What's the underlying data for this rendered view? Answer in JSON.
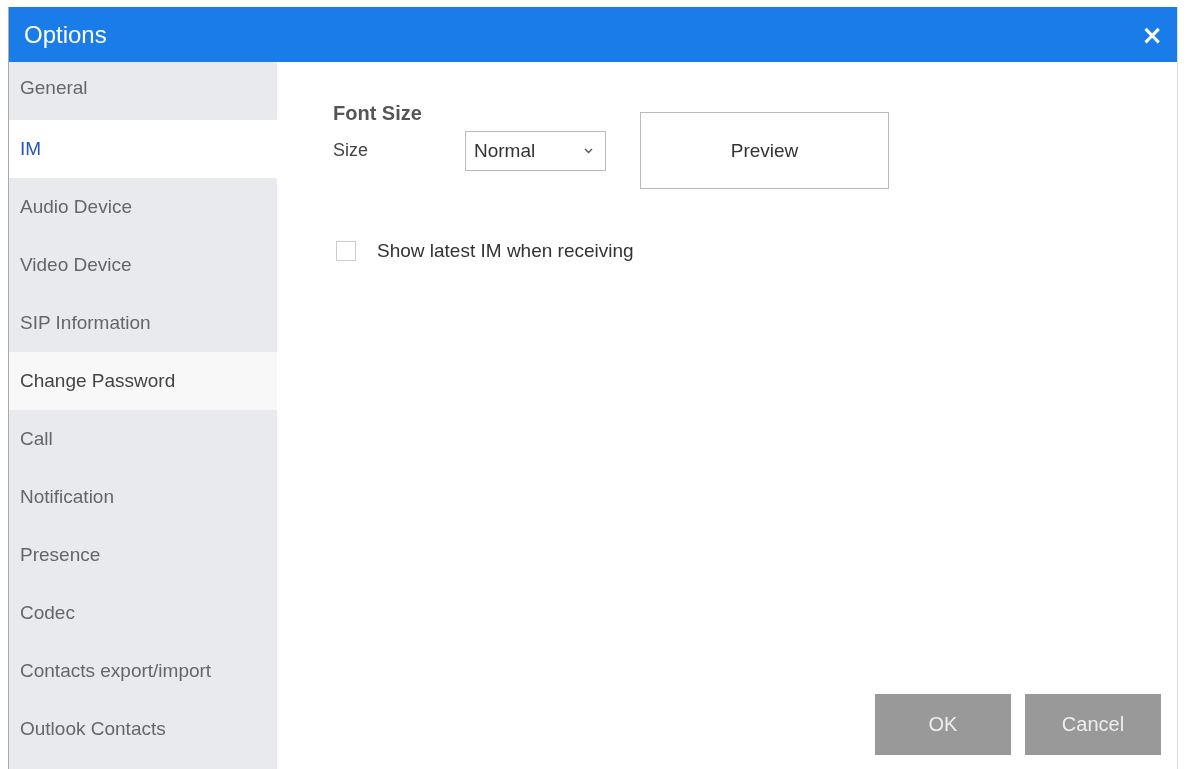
{
  "window": {
    "title": "Options",
    "close": "×"
  },
  "sidebar": {
    "items": [
      {
        "label": "General",
        "selected": false,
        "hovered": false
      },
      {
        "label": "IM",
        "selected": true,
        "hovered": false
      },
      {
        "label": "Audio Device",
        "selected": false,
        "hovered": false
      },
      {
        "label": "Video Device",
        "selected": false,
        "hovered": false
      },
      {
        "label": "SIP Information",
        "selected": false,
        "hovered": false
      },
      {
        "label": "Change Password",
        "selected": false,
        "hovered": true
      },
      {
        "label": "Call",
        "selected": false,
        "hovered": false
      },
      {
        "label": "Notification",
        "selected": false,
        "hovered": false
      },
      {
        "label": "Presence",
        "selected": false,
        "hovered": false
      },
      {
        "label": "Codec",
        "selected": false,
        "hovered": false
      },
      {
        "label": "Contacts export/import",
        "selected": false,
        "hovered": false
      },
      {
        "label": "Outlook Contacts",
        "selected": false,
        "hovered": false
      }
    ]
  },
  "content": {
    "section_title": "Font Size",
    "size_label": "Size",
    "size_value": "Normal",
    "preview_button": "Preview",
    "checkbox": {
      "label": "Show latest IM when receiving",
      "checked": false
    }
  },
  "buttons": [
    {
      "label": "OK"
    },
    {
      "label": "Cancel"
    }
  ]
}
